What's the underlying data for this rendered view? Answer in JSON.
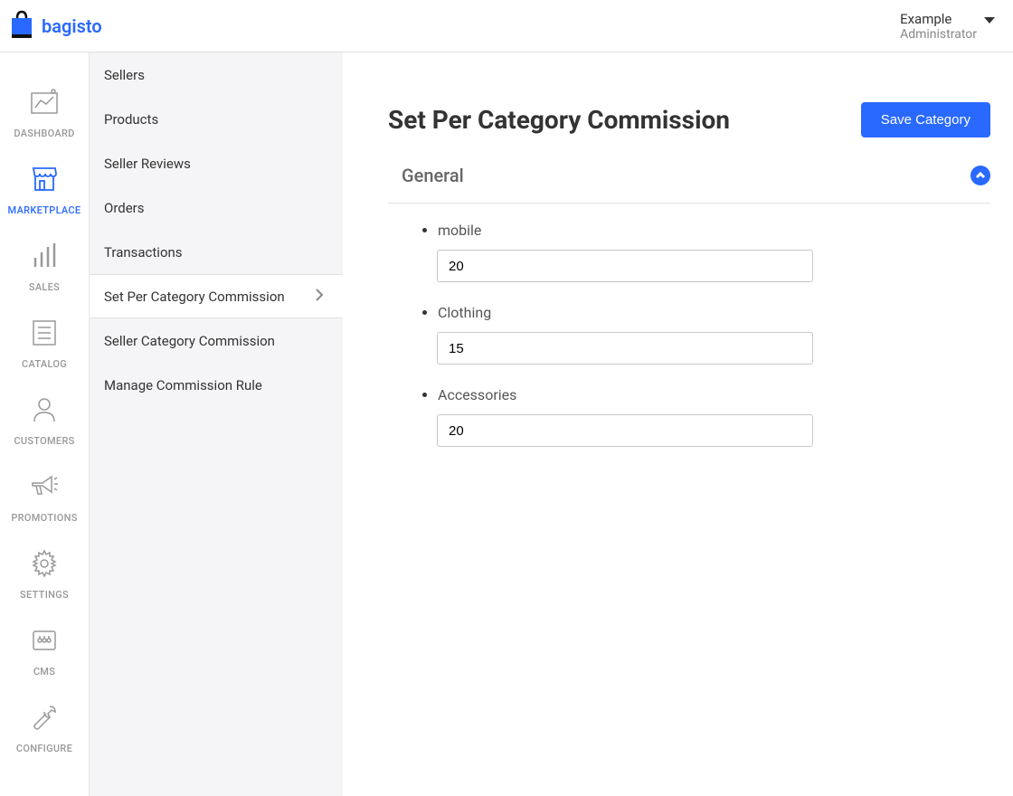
{
  "brand": "bagisto",
  "user": {
    "name": "Example",
    "role": "Administrator"
  },
  "primaryNav": [
    {
      "label": "DASHBOARD"
    },
    {
      "label": "MARKETPLACE"
    },
    {
      "label": "SALES"
    },
    {
      "label": "CATALOG"
    },
    {
      "label": "CUSTOMERS"
    },
    {
      "label": "PROMOTIONS"
    },
    {
      "label": "SETTINGS"
    },
    {
      "label": "CMS"
    },
    {
      "label": "CONFIGURE"
    }
  ],
  "secondaryNav": [
    {
      "label": "Sellers"
    },
    {
      "label": "Products"
    },
    {
      "label": "Seller Reviews"
    },
    {
      "label": "Orders"
    },
    {
      "label": "Transactions"
    },
    {
      "label": "Set Per Category Commission"
    },
    {
      "label": "Seller Category Commission"
    },
    {
      "label": "Manage Commission Rule"
    }
  ],
  "page": {
    "title": "Set Per Category Commission",
    "saveButton": "Save Category",
    "section": "General",
    "fields": [
      {
        "label": "mobile",
        "value": "20"
      },
      {
        "label": "Clothing",
        "value": "15"
      },
      {
        "label": "Accessories",
        "value": "20"
      }
    ]
  }
}
